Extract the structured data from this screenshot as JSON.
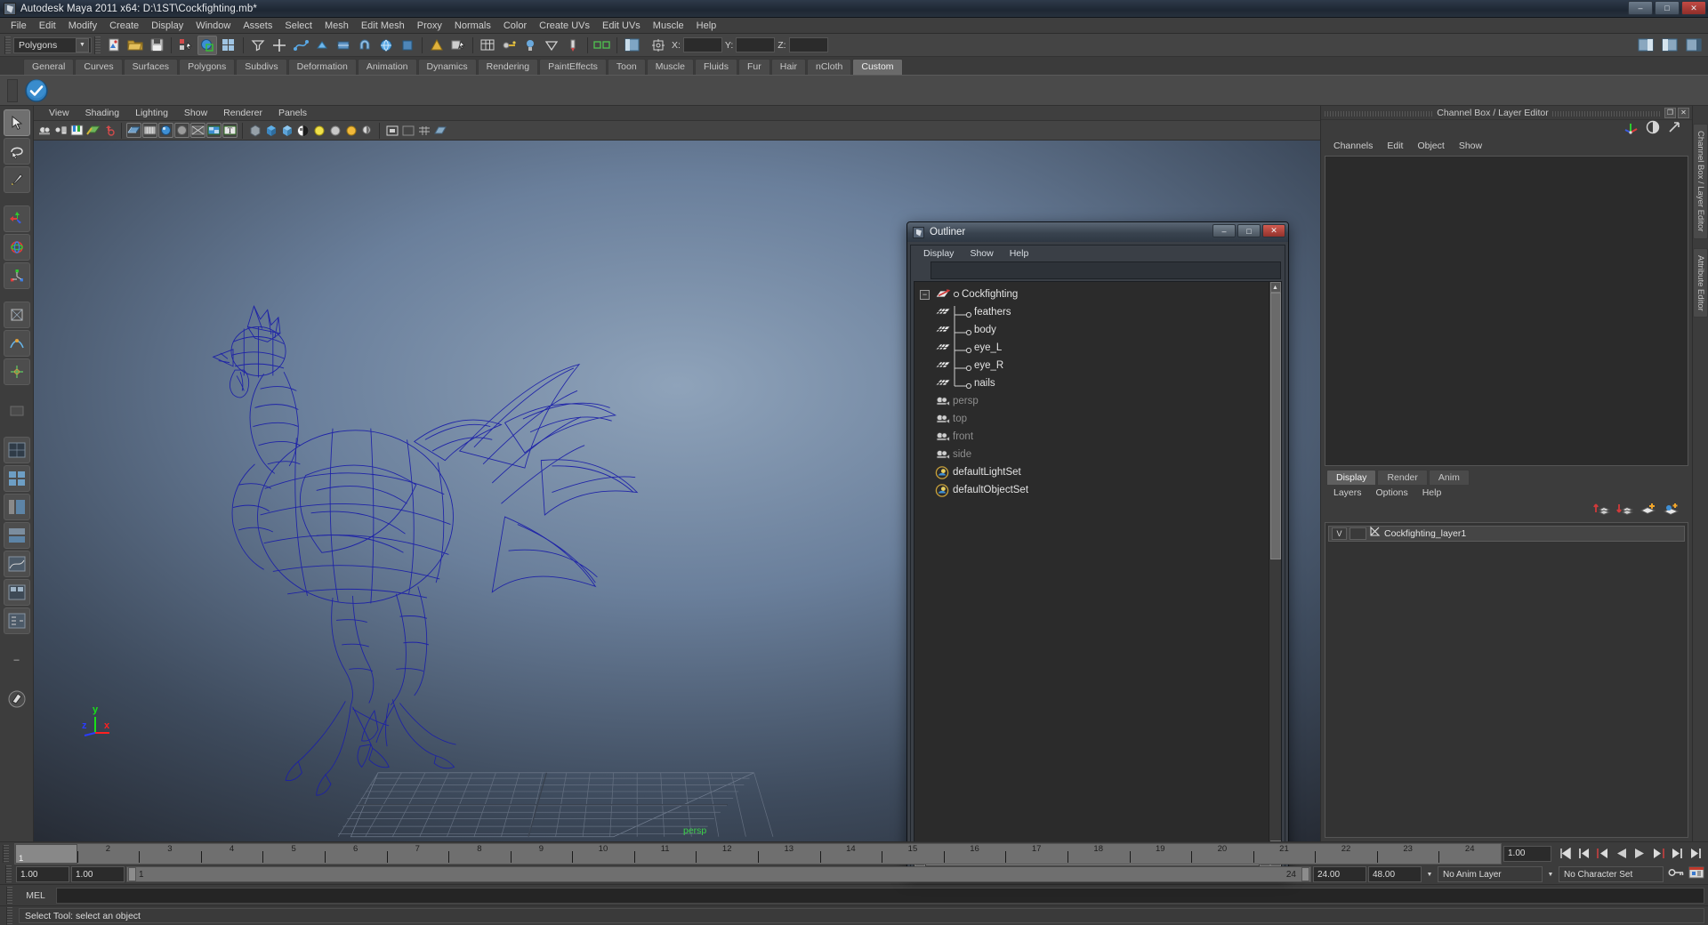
{
  "window": {
    "title": "Autodesk Maya 2011 x64: D:\\1ST\\Cockfighting.mb*",
    "minimize": "–",
    "maximize": "□",
    "close": "✕"
  },
  "menubar": [
    "File",
    "Edit",
    "Modify",
    "Create",
    "Display",
    "Window",
    "Assets",
    "Select",
    "Mesh",
    "Edit Mesh",
    "Proxy",
    "Normals",
    "Color",
    "Create UVs",
    "Edit UVs",
    "Muscle",
    "Help"
  ],
  "statusline": {
    "mode_selected": "Polygons",
    "coord_labels": [
      "X:",
      "Y:",
      "Z:"
    ],
    "coord_values": [
      "",
      "",
      ""
    ]
  },
  "shelf": {
    "tabs": [
      "General",
      "Curves",
      "Surfaces",
      "Polygons",
      "Subdivs",
      "Deformation",
      "Animation",
      "Dynamics",
      "Rendering",
      "PaintEffects",
      "Toon",
      "Muscle",
      "Fluids",
      "Fur",
      "Hair",
      "nCloth",
      "Custom"
    ],
    "active_tab": "Custom"
  },
  "viewport": {
    "menus": [
      "View",
      "Shading",
      "Lighting",
      "Show",
      "Renderer",
      "Panels"
    ],
    "camera_label": "persp",
    "axis": {
      "x": "x",
      "y": "y",
      "z": "z",
      "x_color": "#ff2020",
      "y_color": "#18e018",
      "z_color": "#2a3cff"
    },
    "model_color": "#1b1fa8",
    "model_name": "Cockfighting"
  },
  "outliner": {
    "title": "Outliner",
    "menus": [
      "Display",
      "Show",
      "Help"
    ],
    "search_value": "",
    "tree": [
      {
        "label": "Cockfighting",
        "type": "transform-root",
        "indent": 0,
        "expanded": true,
        "dim": false
      },
      {
        "label": "feathers",
        "type": "mesh",
        "indent": 1,
        "dim": false
      },
      {
        "label": "body",
        "type": "mesh",
        "indent": 1,
        "dim": false
      },
      {
        "label": "eye_L",
        "type": "mesh",
        "indent": 1,
        "dim": false
      },
      {
        "label": "eye_R",
        "type": "mesh",
        "indent": 1,
        "dim": false
      },
      {
        "label": "nails",
        "type": "mesh",
        "indent": 1,
        "dim": false
      },
      {
        "label": "persp",
        "type": "camera",
        "indent": 0,
        "dim": true
      },
      {
        "label": "top",
        "type": "camera",
        "indent": 0,
        "dim": true
      },
      {
        "label": "front",
        "type": "camera",
        "indent": 0,
        "dim": true
      },
      {
        "label": "side",
        "type": "camera",
        "indent": 0,
        "dim": true
      },
      {
        "label": "defaultLightSet",
        "type": "set",
        "indent": 0,
        "dim": false
      },
      {
        "label": "defaultObjectSet",
        "type": "set",
        "indent": 0,
        "dim": false
      }
    ],
    "win_minimize": "–",
    "win_maximize": "□",
    "win_close": "✕"
  },
  "channelbox": {
    "panel_title": "Channel Box / Layer Editor",
    "menus": [
      "Channels",
      "Edit",
      "Object",
      "Show"
    ],
    "restore_btn": "❐",
    "close_btn": "✕"
  },
  "layereditor": {
    "tabs": [
      "Display",
      "Render",
      "Anim"
    ],
    "active_tab": "Display",
    "menus": [
      "Layers",
      "Options",
      "Help"
    ],
    "layers": [
      {
        "visibility": "V",
        "playback": "",
        "name": "Cockfighting_layer1"
      }
    ]
  },
  "vertical_tabs": [
    "Channel Box / Layer Editor",
    "Attribute Editor"
  ],
  "timeline": {
    "frames": [
      1,
      2,
      3,
      4,
      5,
      6,
      7,
      8,
      9,
      10,
      11,
      12,
      13,
      14,
      15,
      16,
      17,
      18,
      19,
      20,
      21,
      22,
      23,
      24
    ],
    "current_frame": "1",
    "current_frame_field": "1.00",
    "playback_buttons": [
      "⏮",
      "⏴|",
      "|◀",
      "◀",
      "▶",
      "▶|",
      "|⏵",
      "⏭"
    ]
  },
  "rangeslider": {
    "anim_start": "1.00",
    "range_start": "1.00",
    "range_start_label": "1",
    "range_end_label": "24",
    "range_end": "24.00",
    "anim_end": "48.00",
    "anim_layer": "No Anim Layer",
    "character_set": "No Character Set"
  },
  "command_line": {
    "label": "MEL",
    "value": ""
  },
  "help_line": {
    "text": "Select Tool: select an object"
  }
}
